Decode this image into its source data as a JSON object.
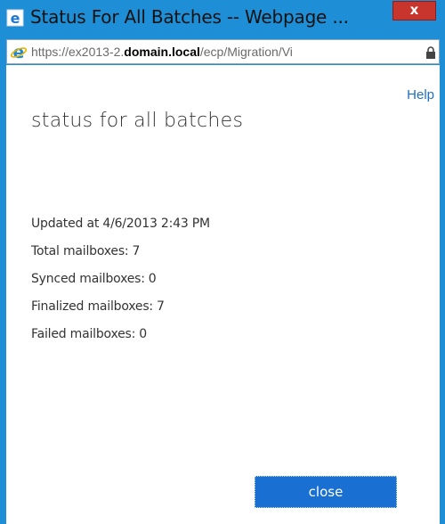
{
  "window": {
    "title": "Status For All Batches -- Webpage ...",
    "close_glyph": "x"
  },
  "address_bar": {
    "url_prefix": "https://ex2013-2.",
    "url_domain": "domain.local",
    "url_suffix": "/ecp/Migration/Vi"
  },
  "page": {
    "help_label": "Help",
    "title": "status for all batches",
    "updated_label": "Updated at",
    "updated_value": "4/6/2013 2:43 PM",
    "stats": [
      {
        "label": "Total mailboxes:",
        "value": "7"
      },
      {
        "label": "Synced mailboxes:",
        "value": "0"
      },
      {
        "label": "Finalized mailboxes:",
        "value": "7"
      },
      {
        "label": "Failed mailboxes:",
        "value": "0"
      }
    ],
    "close_label": "close"
  },
  "colors": {
    "frame": "#1e8fd6",
    "close_button": "#c7352c",
    "primary_button": "#1a6fd2",
    "link": "#1f6fc4"
  },
  "icons": {
    "app": "ie-document-icon",
    "address": "ie-logo-icon",
    "secure": "lock-icon"
  }
}
